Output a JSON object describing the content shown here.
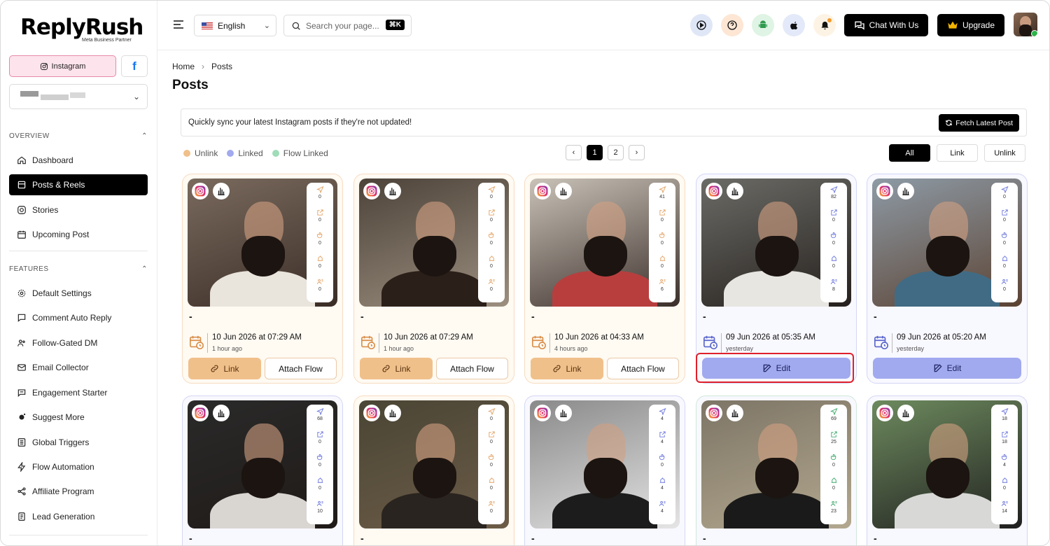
{
  "brand": {
    "name": "ReplyRush",
    "subtitle": "Meta Business Partner"
  },
  "platform": {
    "instagram": "Instagram",
    "facebook": "f"
  },
  "sidebar": {
    "overview_label": "OVERVIEW",
    "overview": [
      {
        "label": "Dashboard",
        "icon": "home-icon"
      },
      {
        "label": "Posts & Reels",
        "icon": "posts-icon"
      },
      {
        "label": "Stories",
        "icon": "instagram-icon"
      },
      {
        "label": "Upcoming Post",
        "icon": "calendar-icon"
      }
    ],
    "features_label": "FEATURES",
    "features": [
      {
        "label": "Default Settings",
        "icon": "gear-icon"
      },
      {
        "label": "Comment Auto Reply",
        "icon": "comment-icon"
      },
      {
        "label": "Follow-Gated DM",
        "icon": "users-icon"
      },
      {
        "label": "Email Collector",
        "icon": "mail-icon"
      },
      {
        "label": "Engagement Starter",
        "icon": "chat-icon"
      },
      {
        "label": "Suggest More",
        "icon": "sparkle-gear-icon"
      },
      {
        "label": "Global Triggers",
        "icon": "list-icon"
      },
      {
        "label": "Flow Automation",
        "icon": "bolt-icon"
      },
      {
        "label": "Affiliate Program",
        "icon": "share-icon"
      },
      {
        "label": "Lead Generation",
        "icon": "doc-icon"
      }
    ]
  },
  "topbar": {
    "language": "English",
    "search_placeholder": "Search your page...",
    "shortcut": "⌘K",
    "chat_label": "Chat With Us",
    "upgrade_label": "Upgrade"
  },
  "breadcrumb": {
    "home": "Home",
    "current": "Posts"
  },
  "page_title": "Posts",
  "sync": {
    "message": "Quickly sync your latest Instagram posts if they're not updated!",
    "button": "Fetch Latest Post"
  },
  "legend": [
    {
      "label": "Unlink",
      "color": "#f0c08a"
    },
    {
      "label": "Linked",
      "color": "#a1a9ef"
    },
    {
      "label": "Flow Linked",
      "color": "#9fdcb8"
    }
  ],
  "pagination": {
    "pages": [
      "1",
      "2"
    ],
    "current": "1"
  },
  "filters": {
    "all": "All",
    "link": "Link",
    "unlink": "Unlink",
    "active": "All"
  },
  "labels": {
    "link": "Link",
    "attach_flow": "Attach Flow",
    "edit": "Edit",
    "caption_placeholder": "-"
  },
  "posts": [
    {
      "status": "unlink",
      "date": "10 Jun 2026 at 07:29 AM",
      "ago": "1 hour ago",
      "stats": [
        "0",
        "0",
        "0",
        "0",
        "0"
      ]
    },
    {
      "status": "unlink",
      "date": "10 Jun 2026 at 07:29 AM",
      "ago": "1 hour ago",
      "stats": [
        "0",
        "0",
        "0",
        "0",
        "0"
      ]
    },
    {
      "status": "unlink",
      "date": "10 Jun 2026 at 04:33 AM",
      "ago": "4 hours ago",
      "stats": [
        "41",
        "0",
        "0",
        "0",
        "6"
      ]
    },
    {
      "status": "linked",
      "date": "09 Jun 2026 at 05:35 AM",
      "ago": "yesterday",
      "stats": [
        "82",
        "0",
        "0",
        "0",
        "8"
      ]
    },
    {
      "status": "linked",
      "date": "09 Jun 2026 at 05:20 AM",
      "ago": "yesterday",
      "stats": [
        "0",
        "0",
        "0",
        "0",
        "0"
      ]
    },
    {
      "status": "linked",
      "stats": [
        "68",
        "0",
        "0",
        "0",
        "10"
      ]
    },
    {
      "status": "unlink",
      "stats": [
        "0",
        "0",
        "0",
        "0",
        "0"
      ]
    },
    {
      "status": "linked",
      "stats": [
        "4",
        "4",
        "0",
        "4",
        "4"
      ]
    },
    {
      "status": "flow",
      "stats": [
        "69",
        "25",
        "0",
        "0",
        "23"
      ]
    },
    {
      "status": "linked",
      "stats": [
        "18",
        "18",
        "4",
        "0",
        "14"
      ]
    }
  ]
}
